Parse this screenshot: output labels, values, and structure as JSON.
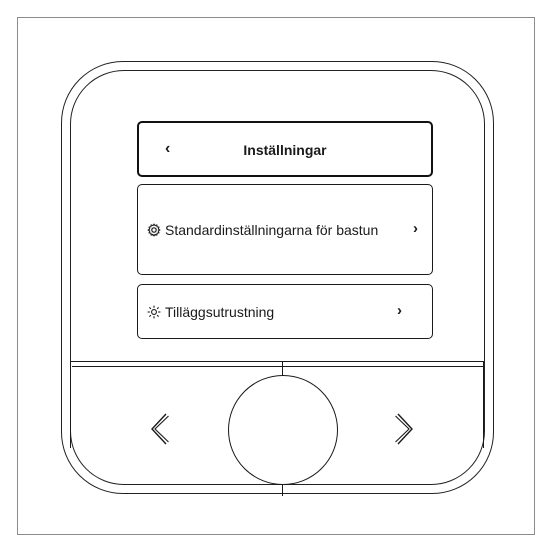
{
  "screen": {
    "header": {
      "back_glyph": "‹",
      "title": "Inställningar"
    },
    "rows": [
      {
        "icon": "gear-icon",
        "label": "Standardinställningarna för bastun",
        "chevron": "›"
      },
      {
        "icon": "light-icon",
        "label": "Tilläggsutrustning",
        "chevron": "›"
      }
    ]
  },
  "controls": {
    "left_icon": "chevron-left-icon",
    "center_icon": "round-knob",
    "right_icon": "chevron-right-icon"
  }
}
